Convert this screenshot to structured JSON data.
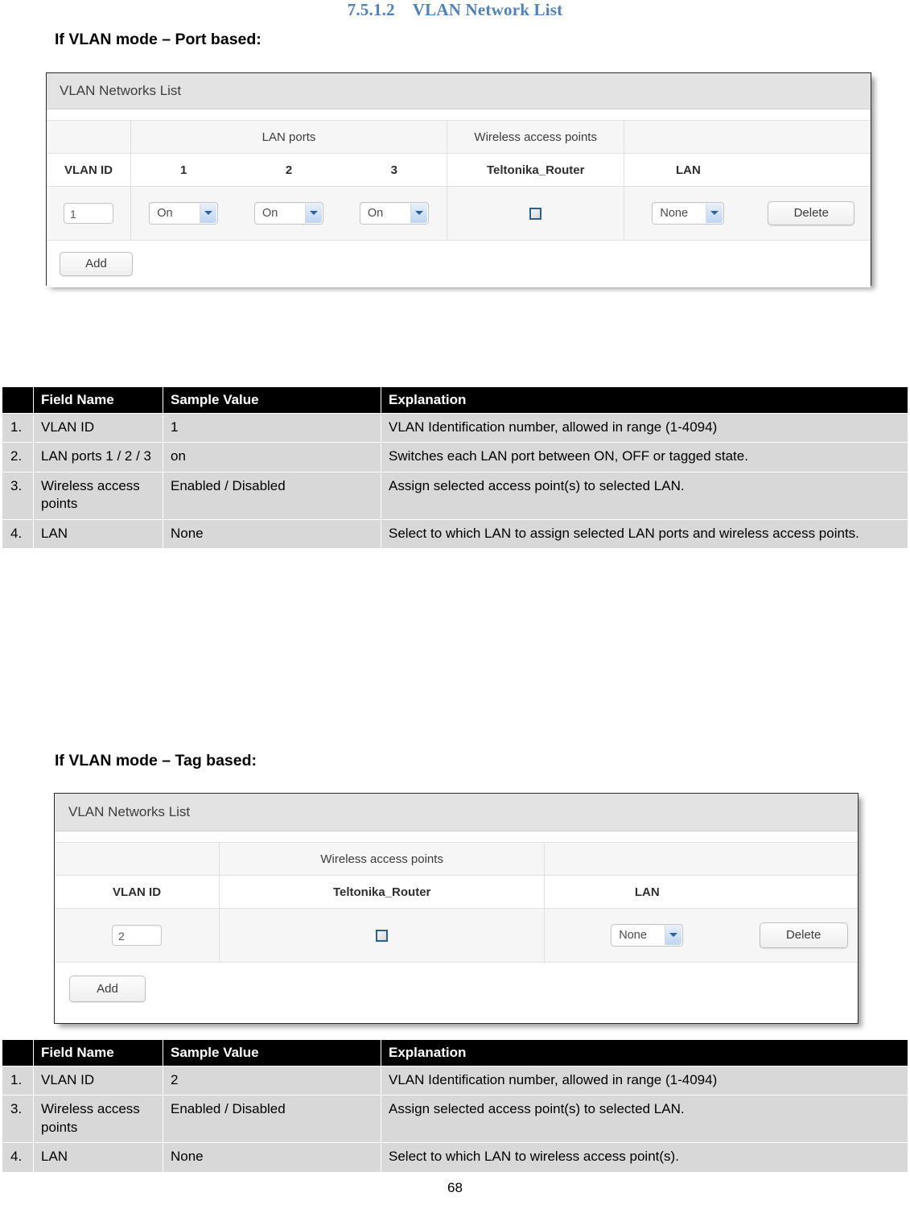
{
  "heading": {
    "number": "7.5.1.2",
    "title": "VLAN Network List"
  },
  "sections": {
    "port_based": {
      "subheading": "If VLAN mode – Port based:",
      "panel": {
        "title": "VLAN Networks List",
        "group_headers": {
          "lan_ports": "LAN ports",
          "wireless_access_points": "Wireless access points"
        },
        "column_headers": {
          "vlan_id": "VLAN ID",
          "port1": "1",
          "port2": "2",
          "port3": "3",
          "ap_name": "Teltonika_Router",
          "lan": "LAN"
        },
        "row": {
          "vlan_id_value": "1",
          "port1_value": "On",
          "port2_value": "On",
          "port3_value": "On",
          "ap_checked": false,
          "lan_value": "None",
          "delete_label": "Delete"
        },
        "add_label": "Add"
      },
      "table": {
        "headers": [
          "",
          "Field Name",
          "Sample Value",
          "Explanation"
        ],
        "rows": [
          {
            "index": "1.",
            "field_name": "VLAN ID",
            "sample_value": "1",
            "explanation": "VLAN Identification number, allowed in range (1-4094)"
          },
          {
            "index": "2.",
            "field_name": "LAN ports\n 1 / 2 / 3",
            "sample_value": "on",
            "explanation": "Switches each LAN port between ON, OFF or tagged state."
          },
          {
            "index": "3.",
            "field_name": "Wireless access points",
            "sample_value": "Enabled / Disabled",
            "explanation": "Assign selected access point(s) to selected LAN."
          },
          {
            "index": "4.",
            "field_name": "LAN",
            "sample_value": "None",
            "explanation": "Select to which LAN to assign selected LAN ports and wireless access points."
          }
        ]
      }
    },
    "tag_based": {
      "subheading": "If VLAN mode – Tag based:",
      "panel": {
        "title": "VLAN Networks List",
        "group_headers": {
          "wireless_access_points": "Wireless access points"
        },
        "column_headers": {
          "vlan_id": "VLAN ID",
          "ap_name": "Teltonika_Router",
          "lan": "LAN"
        },
        "row": {
          "vlan_id_value": "2",
          "ap_checked": false,
          "lan_value": "None",
          "delete_label": "Delete"
        },
        "add_label": "Add"
      },
      "table": {
        "headers": [
          "",
          "Field Name",
          "Sample Value",
          "Explanation"
        ],
        "rows": [
          {
            "index": "1.",
            "field_name": "VLAN ID",
            "sample_value": "2",
            "explanation": "VLAN Identification number, allowed in range (1-4094)"
          },
          {
            "index": "3.",
            "field_name": "Wireless access points",
            "sample_value": "Enabled / Disabled",
            "explanation": "Assign selected access point(s) to selected LAN."
          },
          {
            "index": "4.",
            "field_name": "LAN",
            "sample_value": "None",
            "explanation": "Select to which LAN to wireless access point(s)."
          }
        ]
      }
    }
  },
  "page_number": "68",
  "colors": {
    "heading_blue": "#4f81bd",
    "table_header_bg": "#000000",
    "table_row_bg": "#d8d8d8",
    "panel_title_bg": "#e3e3e3",
    "select_arrow_blue": "#2a5fa5"
  }
}
